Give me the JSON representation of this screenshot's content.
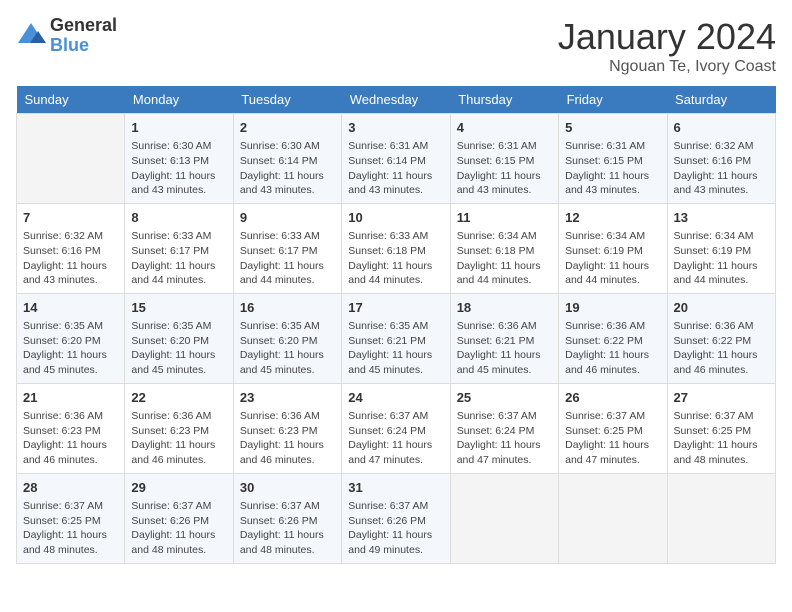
{
  "header": {
    "logo_general": "General",
    "logo_blue": "Blue",
    "month": "January 2024",
    "location": "Ngouan Te, Ivory Coast"
  },
  "days_of_week": [
    "Sunday",
    "Monday",
    "Tuesday",
    "Wednesday",
    "Thursday",
    "Friday",
    "Saturday"
  ],
  "weeks": [
    [
      {
        "day": "",
        "info": ""
      },
      {
        "day": "1",
        "info": "Sunrise: 6:30 AM\nSunset: 6:13 PM\nDaylight: 11 hours\nand 43 minutes."
      },
      {
        "day": "2",
        "info": "Sunrise: 6:30 AM\nSunset: 6:14 PM\nDaylight: 11 hours\nand 43 minutes."
      },
      {
        "day": "3",
        "info": "Sunrise: 6:31 AM\nSunset: 6:14 PM\nDaylight: 11 hours\nand 43 minutes."
      },
      {
        "day": "4",
        "info": "Sunrise: 6:31 AM\nSunset: 6:15 PM\nDaylight: 11 hours\nand 43 minutes."
      },
      {
        "day": "5",
        "info": "Sunrise: 6:31 AM\nSunset: 6:15 PM\nDaylight: 11 hours\nand 43 minutes."
      },
      {
        "day": "6",
        "info": "Sunrise: 6:32 AM\nSunset: 6:16 PM\nDaylight: 11 hours\nand 43 minutes."
      }
    ],
    [
      {
        "day": "7",
        "info": "Sunrise: 6:32 AM\nSunset: 6:16 PM\nDaylight: 11 hours\nand 43 minutes."
      },
      {
        "day": "8",
        "info": "Sunrise: 6:33 AM\nSunset: 6:17 PM\nDaylight: 11 hours\nand 44 minutes."
      },
      {
        "day": "9",
        "info": "Sunrise: 6:33 AM\nSunset: 6:17 PM\nDaylight: 11 hours\nand 44 minutes."
      },
      {
        "day": "10",
        "info": "Sunrise: 6:33 AM\nSunset: 6:18 PM\nDaylight: 11 hours\nand 44 minutes."
      },
      {
        "day": "11",
        "info": "Sunrise: 6:34 AM\nSunset: 6:18 PM\nDaylight: 11 hours\nand 44 minutes."
      },
      {
        "day": "12",
        "info": "Sunrise: 6:34 AM\nSunset: 6:19 PM\nDaylight: 11 hours\nand 44 minutes."
      },
      {
        "day": "13",
        "info": "Sunrise: 6:34 AM\nSunset: 6:19 PM\nDaylight: 11 hours\nand 44 minutes."
      }
    ],
    [
      {
        "day": "14",
        "info": "Sunrise: 6:35 AM\nSunset: 6:20 PM\nDaylight: 11 hours\nand 45 minutes."
      },
      {
        "day": "15",
        "info": "Sunrise: 6:35 AM\nSunset: 6:20 PM\nDaylight: 11 hours\nand 45 minutes."
      },
      {
        "day": "16",
        "info": "Sunrise: 6:35 AM\nSunset: 6:20 PM\nDaylight: 11 hours\nand 45 minutes."
      },
      {
        "day": "17",
        "info": "Sunrise: 6:35 AM\nSunset: 6:21 PM\nDaylight: 11 hours\nand 45 minutes."
      },
      {
        "day": "18",
        "info": "Sunrise: 6:36 AM\nSunset: 6:21 PM\nDaylight: 11 hours\nand 45 minutes."
      },
      {
        "day": "19",
        "info": "Sunrise: 6:36 AM\nSunset: 6:22 PM\nDaylight: 11 hours\nand 46 minutes."
      },
      {
        "day": "20",
        "info": "Sunrise: 6:36 AM\nSunset: 6:22 PM\nDaylight: 11 hours\nand 46 minutes."
      }
    ],
    [
      {
        "day": "21",
        "info": "Sunrise: 6:36 AM\nSunset: 6:23 PM\nDaylight: 11 hours\nand 46 minutes."
      },
      {
        "day": "22",
        "info": "Sunrise: 6:36 AM\nSunset: 6:23 PM\nDaylight: 11 hours\nand 46 minutes."
      },
      {
        "day": "23",
        "info": "Sunrise: 6:36 AM\nSunset: 6:23 PM\nDaylight: 11 hours\nand 46 minutes."
      },
      {
        "day": "24",
        "info": "Sunrise: 6:37 AM\nSunset: 6:24 PM\nDaylight: 11 hours\nand 47 minutes."
      },
      {
        "day": "25",
        "info": "Sunrise: 6:37 AM\nSunset: 6:24 PM\nDaylight: 11 hours\nand 47 minutes."
      },
      {
        "day": "26",
        "info": "Sunrise: 6:37 AM\nSunset: 6:25 PM\nDaylight: 11 hours\nand 47 minutes."
      },
      {
        "day": "27",
        "info": "Sunrise: 6:37 AM\nSunset: 6:25 PM\nDaylight: 11 hours\nand 48 minutes."
      }
    ],
    [
      {
        "day": "28",
        "info": "Sunrise: 6:37 AM\nSunset: 6:25 PM\nDaylight: 11 hours\nand 48 minutes."
      },
      {
        "day": "29",
        "info": "Sunrise: 6:37 AM\nSunset: 6:26 PM\nDaylight: 11 hours\nand 48 minutes."
      },
      {
        "day": "30",
        "info": "Sunrise: 6:37 AM\nSunset: 6:26 PM\nDaylight: 11 hours\nand 48 minutes."
      },
      {
        "day": "31",
        "info": "Sunrise: 6:37 AM\nSunset: 6:26 PM\nDaylight: 11 hours\nand 49 minutes."
      },
      {
        "day": "",
        "info": ""
      },
      {
        "day": "",
        "info": ""
      },
      {
        "day": "",
        "info": ""
      }
    ]
  ]
}
